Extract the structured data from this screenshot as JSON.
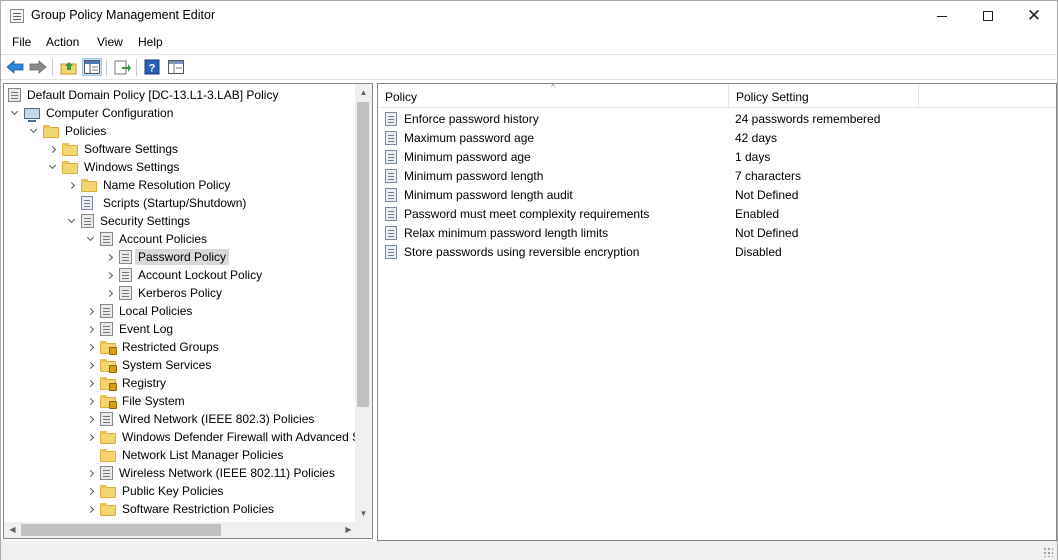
{
  "window": {
    "title": "Group Policy Management Editor"
  },
  "menu": [
    "File",
    "Action",
    "View",
    "Help"
  ],
  "toolbar": {
    "icons": [
      "back-arrow-icon",
      "forward-arrow-icon",
      "up-folder-icon",
      "show-hide-tree-icon",
      "export-list-icon",
      "help-icon",
      "properties-icon"
    ]
  },
  "tree": {
    "root": "Default Domain Policy [DC-13.L1-3.LAB] Policy",
    "nodes": [
      {
        "label": "Computer Configuration",
        "depth": 0,
        "expander": "down",
        "icon": "computer-icon"
      },
      {
        "label": "Policies",
        "depth": 1,
        "expander": "down",
        "icon": "folder-icon"
      },
      {
        "label": "Software Settings",
        "depth": 2,
        "expander": "right",
        "icon": "folder-icon"
      },
      {
        "label": "Windows Settings",
        "depth": 2,
        "expander": "down",
        "icon": "folder-icon"
      },
      {
        "label": "Name Resolution Policy",
        "depth": 3,
        "expander": "right",
        "icon": "folder-icon"
      },
      {
        "label": "Scripts (Startup/Shutdown)",
        "depth": 3,
        "expander": "none",
        "icon": "policy-icon"
      },
      {
        "label": "Security Settings",
        "depth": 3,
        "expander": "down",
        "icon": "gpo-icon"
      },
      {
        "label": "Account Policies",
        "depth": 4,
        "expander": "down",
        "icon": "gpo-icon"
      },
      {
        "label": "Password Policy",
        "depth": 5,
        "expander": "right",
        "icon": "gpo-icon",
        "selected": true
      },
      {
        "label": "Account Lockout Policy",
        "depth": 5,
        "expander": "right",
        "icon": "gpo-icon"
      },
      {
        "label": "Kerberos Policy",
        "depth": 5,
        "expander": "right",
        "icon": "gpo-icon"
      },
      {
        "label": "Local Policies",
        "depth": 4,
        "expander": "right",
        "icon": "gpo-icon"
      },
      {
        "label": "Event Log",
        "depth": 4,
        "expander": "right",
        "icon": "gpo-icon"
      },
      {
        "label": "Restricted Groups",
        "depth": 4,
        "expander": "right",
        "icon": "lockfolder-icon"
      },
      {
        "label": "System Services",
        "depth": 4,
        "expander": "right",
        "icon": "lockfolder-icon"
      },
      {
        "label": "Registry",
        "depth": 4,
        "expander": "right",
        "icon": "lockfolder-icon"
      },
      {
        "label": "File System",
        "depth": 4,
        "expander": "right",
        "icon": "lockfolder-icon"
      },
      {
        "label": "Wired Network (IEEE 802.3) Policies",
        "depth": 4,
        "expander": "right",
        "icon": "gpo-icon"
      },
      {
        "label": "Windows Defender Firewall with Advanced S",
        "depth": 4,
        "expander": "right",
        "icon": "folder-icon"
      },
      {
        "label": "Network List Manager Policies",
        "depth": 4,
        "expander": "none",
        "icon": "folder-icon"
      },
      {
        "label": "Wireless Network (IEEE 802.11) Policies",
        "depth": 4,
        "expander": "right",
        "icon": "gpo-icon"
      },
      {
        "label": "Public Key Policies",
        "depth": 4,
        "expander": "right",
        "icon": "folder-icon"
      },
      {
        "label": "Software Restriction Policies",
        "depth": 4,
        "expander": "right",
        "icon": "folder-icon"
      }
    ]
  },
  "list": {
    "columns": [
      "Policy",
      "Policy Setting"
    ],
    "rows": [
      {
        "policy": "Enforce password history",
        "setting": "24 passwords remembered"
      },
      {
        "policy": "Maximum password age",
        "setting": "42 days"
      },
      {
        "policy": "Minimum password age",
        "setting": "1 days"
      },
      {
        "policy": "Minimum password length",
        "setting": "7 characters"
      },
      {
        "policy": "Minimum password length audit",
        "setting": "Not Defined"
      },
      {
        "policy": "Password must meet complexity requirements",
        "setting": "Enabled"
      },
      {
        "policy": "Relax minimum password length limits",
        "setting": "Not Defined"
      },
      {
        "policy": "Store passwords using reversible encryption",
        "setting": "Disabled"
      }
    ]
  }
}
